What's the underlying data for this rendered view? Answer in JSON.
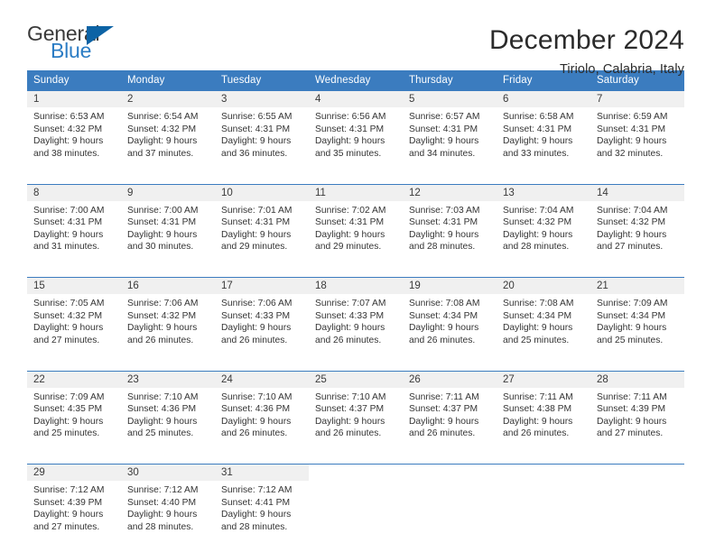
{
  "brand": {
    "name_primary": "General",
    "name_secondary": "Blue",
    "accent_color": "#0d63a5",
    "secondary_color": "#2b7cc4"
  },
  "header": {
    "title": "December 2024",
    "subtitle": "Tiriolo, Calabria, Italy"
  },
  "calendar": {
    "header_bg": "#3b7cbf",
    "daynum_bg": "#f0f0f0",
    "weekday_headers": [
      "Sunday",
      "Monday",
      "Tuesday",
      "Wednesday",
      "Thursday",
      "Friday",
      "Saturday"
    ],
    "weeks": [
      [
        {
          "day": "1",
          "sunrise": "Sunrise: 6:53 AM",
          "sunset": "Sunset: 4:32 PM",
          "daylight_1": "Daylight: 9 hours",
          "daylight_2": "and 38 minutes."
        },
        {
          "day": "2",
          "sunrise": "Sunrise: 6:54 AM",
          "sunset": "Sunset: 4:32 PM",
          "daylight_1": "Daylight: 9 hours",
          "daylight_2": "and 37 minutes."
        },
        {
          "day": "3",
          "sunrise": "Sunrise: 6:55 AM",
          "sunset": "Sunset: 4:31 PM",
          "daylight_1": "Daylight: 9 hours",
          "daylight_2": "and 36 minutes."
        },
        {
          "day": "4",
          "sunrise": "Sunrise: 6:56 AM",
          "sunset": "Sunset: 4:31 PM",
          "daylight_1": "Daylight: 9 hours",
          "daylight_2": "and 35 minutes."
        },
        {
          "day": "5",
          "sunrise": "Sunrise: 6:57 AM",
          "sunset": "Sunset: 4:31 PM",
          "daylight_1": "Daylight: 9 hours",
          "daylight_2": "and 34 minutes."
        },
        {
          "day": "6",
          "sunrise": "Sunrise: 6:58 AM",
          "sunset": "Sunset: 4:31 PM",
          "daylight_1": "Daylight: 9 hours",
          "daylight_2": "and 33 minutes."
        },
        {
          "day": "7",
          "sunrise": "Sunrise: 6:59 AM",
          "sunset": "Sunset: 4:31 PM",
          "daylight_1": "Daylight: 9 hours",
          "daylight_2": "and 32 minutes."
        }
      ],
      [
        {
          "day": "8",
          "sunrise": "Sunrise: 7:00 AM",
          "sunset": "Sunset: 4:31 PM",
          "daylight_1": "Daylight: 9 hours",
          "daylight_2": "and 31 minutes."
        },
        {
          "day": "9",
          "sunrise": "Sunrise: 7:00 AM",
          "sunset": "Sunset: 4:31 PM",
          "daylight_1": "Daylight: 9 hours",
          "daylight_2": "and 30 minutes."
        },
        {
          "day": "10",
          "sunrise": "Sunrise: 7:01 AM",
          "sunset": "Sunset: 4:31 PM",
          "daylight_1": "Daylight: 9 hours",
          "daylight_2": "and 29 minutes."
        },
        {
          "day": "11",
          "sunrise": "Sunrise: 7:02 AM",
          "sunset": "Sunset: 4:31 PM",
          "daylight_1": "Daylight: 9 hours",
          "daylight_2": "and 29 minutes."
        },
        {
          "day": "12",
          "sunrise": "Sunrise: 7:03 AM",
          "sunset": "Sunset: 4:31 PM",
          "daylight_1": "Daylight: 9 hours",
          "daylight_2": "and 28 minutes."
        },
        {
          "day": "13",
          "sunrise": "Sunrise: 7:04 AM",
          "sunset": "Sunset: 4:32 PM",
          "daylight_1": "Daylight: 9 hours",
          "daylight_2": "and 28 minutes."
        },
        {
          "day": "14",
          "sunrise": "Sunrise: 7:04 AM",
          "sunset": "Sunset: 4:32 PM",
          "daylight_1": "Daylight: 9 hours",
          "daylight_2": "and 27 minutes."
        }
      ],
      [
        {
          "day": "15",
          "sunrise": "Sunrise: 7:05 AM",
          "sunset": "Sunset: 4:32 PM",
          "daylight_1": "Daylight: 9 hours",
          "daylight_2": "and 27 minutes."
        },
        {
          "day": "16",
          "sunrise": "Sunrise: 7:06 AM",
          "sunset": "Sunset: 4:32 PM",
          "daylight_1": "Daylight: 9 hours",
          "daylight_2": "and 26 minutes."
        },
        {
          "day": "17",
          "sunrise": "Sunrise: 7:06 AM",
          "sunset": "Sunset: 4:33 PM",
          "daylight_1": "Daylight: 9 hours",
          "daylight_2": "and 26 minutes."
        },
        {
          "day": "18",
          "sunrise": "Sunrise: 7:07 AM",
          "sunset": "Sunset: 4:33 PM",
          "daylight_1": "Daylight: 9 hours",
          "daylight_2": "and 26 minutes."
        },
        {
          "day": "19",
          "sunrise": "Sunrise: 7:08 AM",
          "sunset": "Sunset: 4:34 PM",
          "daylight_1": "Daylight: 9 hours",
          "daylight_2": "and 26 minutes."
        },
        {
          "day": "20",
          "sunrise": "Sunrise: 7:08 AM",
          "sunset": "Sunset: 4:34 PM",
          "daylight_1": "Daylight: 9 hours",
          "daylight_2": "and 25 minutes."
        },
        {
          "day": "21",
          "sunrise": "Sunrise: 7:09 AM",
          "sunset": "Sunset: 4:34 PM",
          "daylight_1": "Daylight: 9 hours",
          "daylight_2": "and 25 minutes."
        }
      ],
      [
        {
          "day": "22",
          "sunrise": "Sunrise: 7:09 AM",
          "sunset": "Sunset: 4:35 PM",
          "daylight_1": "Daylight: 9 hours",
          "daylight_2": "and 25 minutes."
        },
        {
          "day": "23",
          "sunrise": "Sunrise: 7:10 AM",
          "sunset": "Sunset: 4:36 PM",
          "daylight_1": "Daylight: 9 hours",
          "daylight_2": "and 25 minutes."
        },
        {
          "day": "24",
          "sunrise": "Sunrise: 7:10 AM",
          "sunset": "Sunset: 4:36 PM",
          "daylight_1": "Daylight: 9 hours",
          "daylight_2": "and 26 minutes."
        },
        {
          "day": "25",
          "sunrise": "Sunrise: 7:10 AM",
          "sunset": "Sunset: 4:37 PM",
          "daylight_1": "Daylight: 9 hours",
          "daylight_2": "and 26 minutes."
        },
        {
          "day": "26",
          "sunrise": "Sunrise: 7:11 AM",
          "sunset": "Sunset: 4:37 PM",
          "daylight_1": "Daylight: 9 hours",
          "daylight_2": "and 26 minutes."
        },
        {
          "day": "27",
          "sunrise": "Sunrise: 7:11 AM",
          "sunset": "Sunset: 4:38 PM",
          "daylight_1": "Daylight: 9 hours",
          "daylight_2": "and 26 minutes."
        },
        {
          "day": "28",
          "sunrise": "Sunrise: 7:11 AM",
          "sunset": "Sunset: 4:39 PM",
          "daylight_1": "Daylight: 9 hours",
          "daylight_2": "and 27 minutes."
        }
      ],
      [
        {
          "day": "29",
          "sunrise": "Sunrise: 7:12 AM",
          "sunset": "Sunset: 4:39 PM",
          "daylight_1": "Daylight: 9 hours",
          "daylight_2": "and 27 minutes."
        },
        {
          "day": "30",
          "sunrise": "Sunrise: 7:12 AM",
          "sunset": "Sunset: 4:40 PM",
          "daylight_1": "Daylight: 9 hours",
          "daylight_2": "and 28 minutes."
        },
        {
          "day": "31",
          "sunrise": "Sunrise: 7:12 AM",
          "sunset": "Sunset: 4:41 PM",
          "daylight_1": "Daylight: 9 hours",
          "daylight_2": "and 28 minutes."
        },
        {
          "day": "",
          "sunrise": "",
          "sunset": "",
          "daylight_1": "",
          "daylight_2": ""
        },
        {
          "day": "",
          "sunrise": "",
          "sunset": "",
          "daylight_1": "",
          "daylight_2": ""
        },
        {
          "day": "",
          "sunrise": "",
          "sunset": "",
          "daylight_1": "",
          "daylight_2": ""
        },
        {
          "day": "",
          "sunrise": "",
          "sunset": "",
          "daylight_1": "",
          "daylight_2": ""
        }
      ]
    ]
  }
}
